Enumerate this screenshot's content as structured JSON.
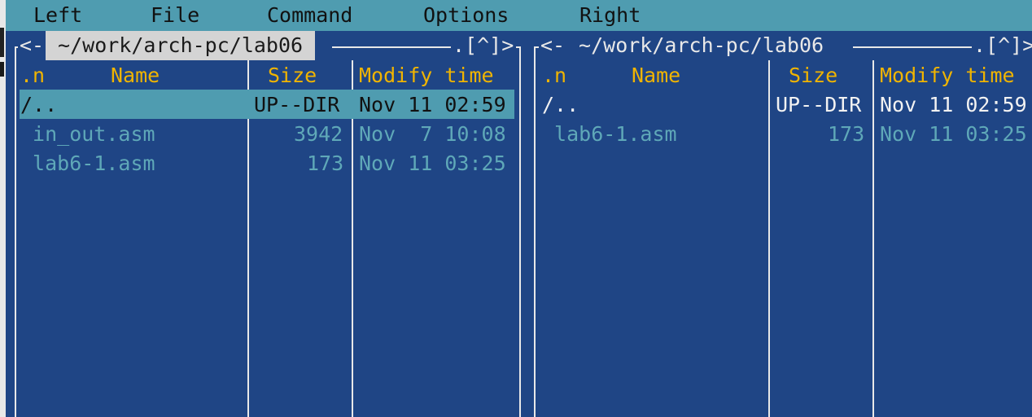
{
  "menu": {
    "left": "Left",
    "file": "File",
    "command": "Command",
    "options": "Options",
    "right": "Right"
  },
  "left_panel": {
    "nav_prefix": "<-",
    "path": " ~/work/arch-pc/lab06 ",
    "history": ".[^]>",
    "headers": {
      "n": ".n",
      "name": "Name",
      "size": "Size",
      "modify": "Modify time"
    },
    "rows": [
      {
        "name": "/..",
        "size": "UP--DIR",
        "modify": "Nov 11 02:59"
      },
      {
        "name": " in_out.asm",
        "size": "3942",
        "modify": "Nov  7 10:08"
      },
      {
        "name": " lab6-1.asm",
        "size": "173",
        "modify": "Nov 11 03:25"
      }
    ]
  },
  "right_panel": {
    "nav_prefix": "<-",
    "path": " ~/work/arch-pc/lab06 ",
    "history": ".[^]>",
    "headers": {
      "n": ".n",
      "name": "Name",
      "size": "Size",
      "modify": "Modify time"
    },
    "rows": [
      {
        "name": "/..",
        "size": "UP--DIR",
        "modify": "Nov 11 02:59"
      },
      {
        "name": " lab6-1.asm",
        "size": "173",
        "modify": "Nov 11 03:25"
      }
    ]
  },
  "colors": {
    "background": "#1f4585",
    "menubar": "#4f9cb0",
    "header": "#f0b400",
    "file": "#5fa8b8",
    "frame": "#e8e8e8"
  }
}
